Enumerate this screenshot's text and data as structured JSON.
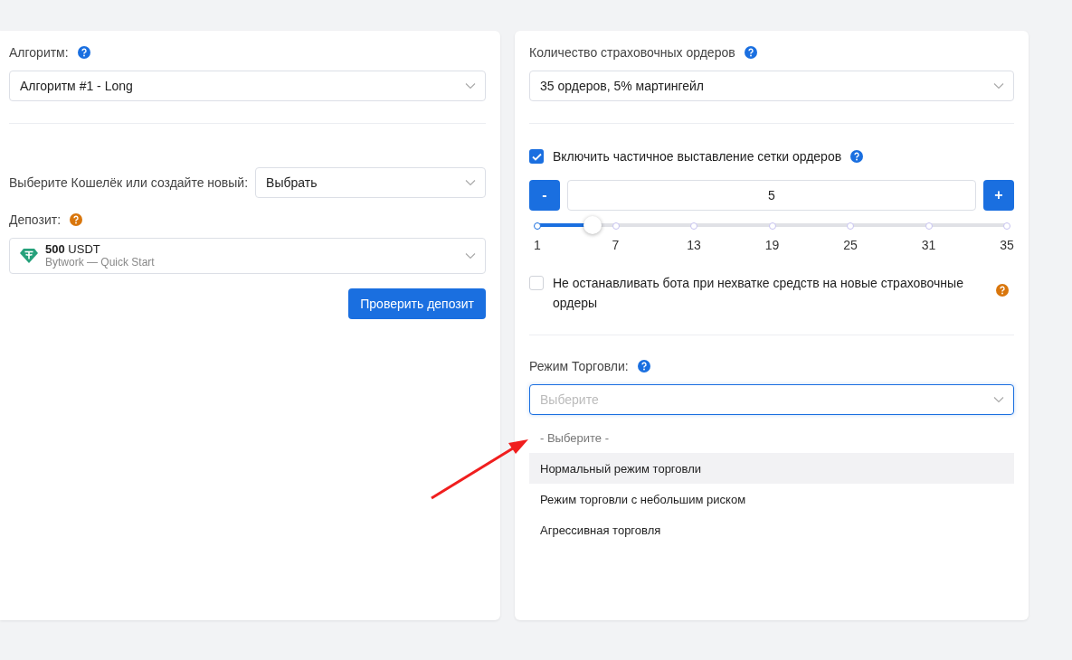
{
  "left": {
    "algorithm": {
      "label": "Алгоритм:",
      "help": {
        "color": "#1a6fe0"
      },
      "value": "Алгоритм #1 - Long"
    },
    "wallet": {
      "label": "Выберите Кошелёк или создайте новый:",
      "value": "Выбрать"
    },
    "deposit": {
      "label": "Депозит:",
      "help": {
        "color": "#d9760c"
      },
      "amount": "500",
      "currency": "USDT",
      "source": "Bytwork — Quick Start"
    },
    "check_button": "Проверить депозит"
  },
  "right": {
    "orders": {
      "label": "Количество страховочных ордеров",
      "help": {
        "color": "#1a6fe0"
      },
      "value": "35 ордеров, 5% мартингейл"
    },
    "partial_grid": {
      "label": "Включить частичное выставление сетки ордеров",
      "help": {
        "color": "#1a6fe0"
      },
      "checked": true
    },
    "stepper": {
      "minus": "-",
      "value": "5",
      "plus": "+"
    },
    "slider": {
      "level": 0.118,
      "ticks": [
        "1",
        "7",
        "13",
        "19",
        "25",
        "31",
        "35"
      ]
    },
    "no_stop": {
      "label": "Не останавливать бота при нехватке средств на новые страховочные ордеры",
      "help": {
        "color": "#d9760c"
      },
      "checked": false
    },
    "trade_mode": {
      "label": "Режим Торговли:",
      "help": {
        "color": "#1a6fe0"
      },
      "placeholder": "Выберите",
      "options": [
        {
          "label": "- Выберите -",
          "kind": "placeholder",
          "selected": false
        },
        {
          "label": "Нормальный режим торговли",
          "kind": "option",
          "selected": true
        },
        {
          "label": "Режим торговли с небольшим риском",
          "kind": "option",
          "selected": false
        },
        {
          "label": "Агрессивная торговля",
          "kind": "option",
          "selected": false
        }
      ]
    }
  }
}
